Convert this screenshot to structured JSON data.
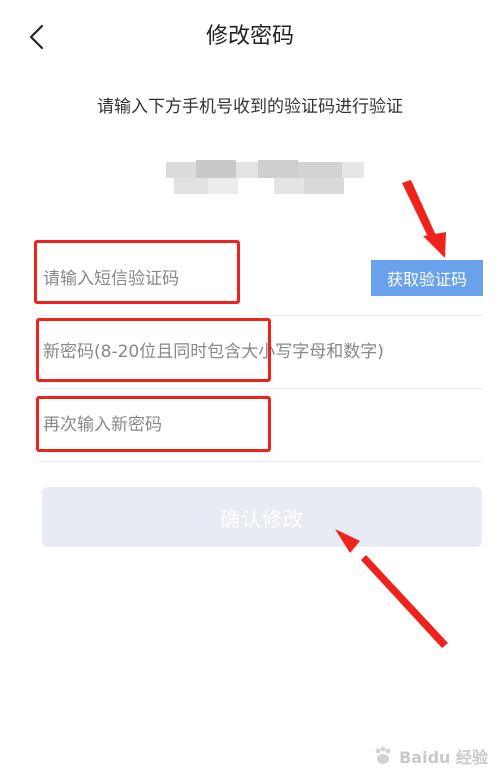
{
  "header": {
    "title": "修改密码",
    "back_icon": "chevron-left-icon"
  },
  "instruction": "请输入下方手机号收到的验证码进行验证",
  "form": {
    "sms_code_placeholder": "请输入短信验证码",
    "get_code_label": "获取验证码",
    "new_password_placeholder": "新密码(8-20位且同时包含大小写字母和数字)",
    "confirm_password_placeholder": "再次输入新密码",
    "confirm_label": "确认修改"
  },
  "watermark": {
    "brand": "Baidu 经验"
  },
  "colors": {
    "get_code_bg": "#6aa1ec",
    "confirm_bg_disabled": "#e8ebf4",
    "annotation_red": "#f0221c"
  }
}
